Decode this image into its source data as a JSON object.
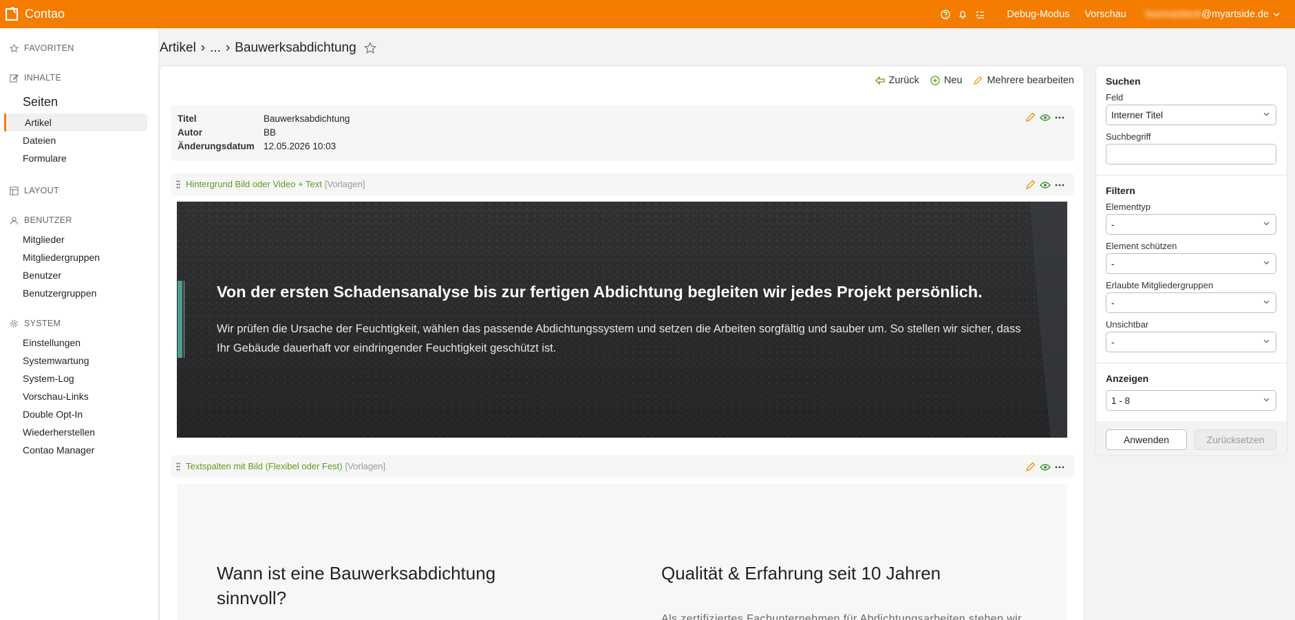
{
  "header": {
    "app_name": "Contao",
    "debug_label": "Debug-Modus",
    "preview_label": "Vorschau",
    "user_blur": "bsemacbeck",
    "user_domain": "@myartside.de"
  },
  "sidebar": {
    "favorites": "FAVORITEN",
    "content": "INHALTE",
    "content_items": [
      "Seiten",
      "Artikel",
      "Dateien",
      "Formulare"
    ],
    "layout": "LAYOUT",
    "users": "BENUTZER",
    "user_items": [
      "Mitglieder",
      "Mitgliedergruppen",
      "Benutzer",
      "Benutzergruppen"
    ],
    "system": "SYSTEM",
    "system_items": [
      "Einstellungen",
      "Systemwartung",
      "System-Log",
      "Vorschau-Links",
      "Double Opt-In",
      "Wiederherstellen",
      "Contao Manager"
    ]
  },
  "breadcrumb": {
    "root": "Artikel",
    "sep1": "›",
    "ellipsis": "...",
    "sep2": "›",
    "current": "Bauwerksabdichtung"
  },
  "toolbar": {
    "back": "Zurück",
    "new": "Neu",
    "edit_multiple": "Mehrere bearbeiten"
  },
  "article_info": {
    "title_label": "Titel",
    "title_value": "Bauwerksabdichtung",
    "author_label": "Autor",
    "author_value": "BB",
    "date_label": "Änderungsdatum",
    "date_value": "12.05.2026 10:03"
  },
  "element1": {
    "type": "Hintergrund Bild oder Video + Text",
    "tag": "[Vorlagen]",
    "heading": "Von der ersten Schadensanalyse bis zur fertigen Abdichtung begleiten wir jedes Projekt persönlich.",
    "text": "Wir prüfen die Ursache der Feuchtigkeit, wählen das passende Abdichtungssystem und setzen die Arbeiten sorgfältig und sauber um. So stellen wir sicher, dass Ihr Gebäude dauerhaft vor eindringender Feuchtigkeit geschützt ist."
  },
  "element2": {
    "type": "Textspalten mit Bild (Flexibel oder Fest)",
    "tag": "[Vorlagen]",
    "col1_heading": "Wann ist eine Bauwerksabdichtung sinnvoll?",
    "col2_heading": "Qualität & Erfahrung seit 10 Jahren",
    "col2_text": "Als zertifiziertes Fachunternehmen für Abdichtungsarbeiten stehen wir"
  },
  "panel": {
    "search_title": "Suchen",
    "field_label": "Feld",
    "field_value": "Interner Titel",
    "term_label": "Suchbegriff",
    "term_value": "",
    "filter_title": "Filtern",
    "elementtype_label": "Elementtyp",
    "elementtype_value": "-",
    "protect_label": "Element schützen",
    "protect_value": "-",
    "groups_label": "Erlaubte Mitgliedergruppen",
    "groups_value": "-",
    "invisible_label": "Unsichtbar",
    "invisible_value": "-",
    "show_title": "Anzeigen",
    "show_value": "1 - 8",
    "apply": "Anwenden",
    "reset": "Zurücksetzen"
  },
  "colors": {
    "brand": "#f47c00",
    "type_green": "#5b9d1a",
    "edit_orange": "#e4a11b",
    "eye_green": "#4a8f3a"
  }
}
